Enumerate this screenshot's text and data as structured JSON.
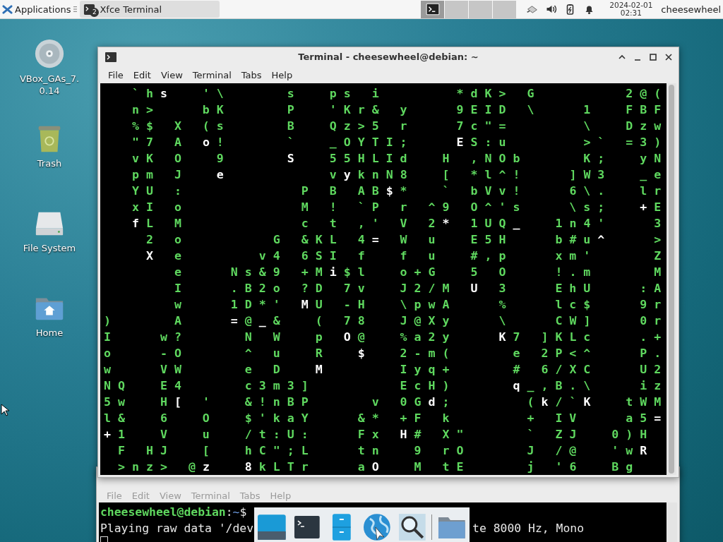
{
  "top_panel": {
    "apps_menu": "Applications",
    "task": {
      "label": "Xfce Terminal",
      "count": "2"
    },
    "workspaces": [
      {
        "selected": true
      },
      {
        "selected": false
      },
      {
        "selected": false
      },
      {
        "selected": false
      }
    ],
    "clock": {
      "date": "2024-02-01",
      "time": "02:31"
    },
    "user": "cheesewheel"
  },
  "desktop_icons": [
    {
      "label": "VBox_GAs_7.0.14",
      "kind": "disc"
    },
    {
      "label": "Trash",
      "kind": "trash"
    },
    {
      "label": "File System",
      "kind": "drive"
    },
    {
      "label": "Home",
      "kind": "home"
    }
  ],
  "front_window": {
    "title": "Terminal - cheesewheel@debian: ~",
    "menu": [
      "File",
      "Edit",
      "View",
      "Terminal",
      "Tabs",
      "Help"
    ],
    "matrix_lines": [
      {
        "runs": [
          {
            "text": "    ` h ",
            "bright": false
          },
          {
            "text": "s",
            "bright": true
          },
          {
            "text": "     ' \\         s     p s   i           * d K >   G             2 @ (",
            "bright": false
          }
        ]
      },
      {
        "runs": [
          {
            "text": "    n >       b K         P     ' K r &   y       9 E I D   \\       1     F B F",
            "bright": false
          }
        ]
      },
      {
        "runs": [
          {
            "text": "    % $   X   ( s         B     Q z > 5   r       7 c \" =           \\     D z w",
            "bright": false
          }
        ]
      },
      {
        "runs": [
          {
            "text": "    \" 7   A   ",
            "bright": false
          },
          {
            "text": "o",
            "bright": true
          },
          {
            "text": " !         `     _ O Y T I ;       ",
            "bright": false
          },
          {
            "text": "E",
            "bright": true
          },
          {
            "text": " S : u           > `   = 3 )",
            "bright": false
          }
        ]
      },
      {
        "runs": [
          {
            "text": "    v K   O     9         ",
            "bright": false
          },
          {
            "text": "S",
            "bright": true
          },
          {
            "text": "     5 5 H L I d     H   , N O b         K ;     y N",
            "bright": false
          }
        ]
      },
      {
        "runs": [
          {
            "text": "    p m   J     ",
            "bright": false
          },
          {
            "text": "e",
            "bright": true
          },
          {
            "text": "               v ",
            "bright": false
          },
          {
            "text": "y",
            "bright": true
          },
          {
            "text": " k n N 8     [   * l ^ !       ] W 3     _ e",
            "bright": false
          }
        ]
      },
      {
        "runs": [
          {
            "text": "    Y U   :                 P   B   A B ",
            "bright": false
          },
          {
            "text": "$",
            "bright": true
          },
          {
            "text": " *     `   b V v !       6 \\ .     l r",
            "bright": false
          }
        ]
      },
      {
        "runs": [
          {
            "text": "    x I   o                 M   !   ` P   r   ^ 9   O ^ ' s       \\ s ;     ",
            "bright": false
          },
          {
            "text": "+",
            "bright": true
          },
          {
            "text": " E",
            "bright": false
          }
        ]
      },
      {
        "runs": [
          {
            "text": "    f",
            "bright": true
          },
          {
            "text": " L   M                 c   t   , '   V   2 ",
            "bright": false
          },
          {
            "text": "*",
            "bright": true
          },
          {
            "text": "   1 U Q ",
            "bright": false
          },
          {
            "text": "_",
            "bright": true
          },
          {
            "text": "     1 n 4 '       3",
            "bright": false
          }
        ]
      },
      {
        "runs": [
          {
            "text": "      2   o             G   & K L   4 ",
            "bright": false
          },
          {
            "text": "=",
            "bright": true
          },
          {
            "text": "   W   u     E 5 H       b # u ",
            "bright": false
          },
          {
            "text": "^",
            "bright": true
          },
          {
            "text": "       >",
            "bright": false
          }
        ]
      },
      {
        "runs": [
          {
            "text": "      X",
            "bright": true
          },
          {
            "text": "   e           v 4   6 S I   f     f   u     # , p       x m '         Z",
            "bright": false
          }
        ]
      },
      {
        "runs": [
          {
            "text": "          e       N s & 9   + M ",
            "bright": false
          },
          {
            "text": "i",
            "bright": true
          },
          {
            "text": " $ l     o + G     5   O       ! . m         M",
            "bright": false
          }
        ]
      },
      {
        "runs": [
          {
            "text": "          I       . B 2 o   ? D   7 v     J 2 / M   ",
            "bright": false
          },
          {
            "text": "U",
            "bright": true
          },
          {
            "text": "   3       E h U       : A",
            "bright": false
          }
        ]
      },
      {
        "runs": [
          {
            "text": "          w       1 D * '   ",
            "bright": false
          },
          {
            "text": "M",
            "bright": true
          },
          {
            "text": " U   - H     \\ p w A       %       l c $       9 r",
            "bright": false
          }
        ]
      },
      {
        "runs": [
          {
            "text": ")         A       ",
            "bright": false
          },
          {
            "text": "=",
            "bright": true
          },
          {
            "text": " @ ",
            "bright": false
          },
          {
            "text": "_",
            "bright": true
          },
          {
            "text": " &     (   7 8     J @ X y       \\       C W ]       0 r",
            "bright": false
          }
        ]
      },
      {
        "runs": [
          {
            "text": "I       w ?         N   W     p   ",
            "bright": false
          },
          {
            "text": "O",
            "bright": true
          },
          {
            "text": " @     % a 2 y       ",
            "bright": false
          },
          {
            "text": "K",
            "bright": true
          },
          {
            "text": " 7   ] K L c       . +",
            "bright": false
          }
        ]
      },
      {
        "runs": [
          {
            "text": "o       - O         ^   u     R     ",
            "bright": false
          },
          {
            "text": "$",
            "bright": true
          },
          {
            "text": "     2 - m (         e   2 P < ^       P .",
            "bright": false
          }
        ]
      },
      {
        "runs": [
          {
            "text": "w       V W         e   D     ",
            "bright": false
          },
          {
            "text": "M",
            "bright": true
          },
          {
            "text": "           I y q +         #   6 / X C       U 2",
            "bright": false
          }
        ]
      },
      {
        "runs": [
          {
            "text": "N Q     E 4         c 3 m 3 ]             E c H )         ",
            "bright": false
          },
          {
            "text": "q",
            "bright": true
          },
          {
            "text": " _ , B . \\       i z",
            "bright": false
          }
        ]
      },
      {
        "runs": [
          {
            "text": "5 w     H ",
            "bright": false
          },
          {
            "text": "[",
            "bright": true
          },
          {
            "text": "   '     & ! n B P         v   0 G ",
            "bright": false
          },
          {
            "text": "d",
            "bright": true
          },
          {
            "text": " ;           ( ",
            "bright": false
          },
          {
            "text": "k",
            "bright": true
          },
          {
            "text": " / ` ",
            "bright": false
          },
          {
            "text": "K",
            "bright": true
          },
          {
            "text": "     t W M",
            "bright": false
          }
        ]
      },
      {
        "runs": [
          {
            "text": "l &     6     O     $ ' k a Y       & *   + F   k           +   I V       a 5 ",
            "bright": false
          },
          {
            "text": "=",
            "bright": true
          }
        ]
      },
      {
        "runs": [
          {
            "text": "+",
            "bright": true
          },
          {
            "text": " 1     V     u     / t : U :       F x   ",
            "bright": false
          },
          {
            "text": "H",
            "bright": true
          },
          {
            "text": " #   X \"         `   Z J     0 ) H",
            "bright": false
          }
        ]
      },
      {
        "runs": [
          {
            "text": "  F   H J     [     h C \" ; L       t n     9   r O         J   / @     ' w ",
            "bright": false
          },
          {
            "text": "R",
            "bright": true
          }
        ]
      },
      {
        "runs": [
          {
            "text": "  > n z >   @ ",
            "bright": false
          },
          {
            "text": "z     8",
            "bright": true
          },
          {
            "text": " k L T r       a ",
            "bright": false
          },
          {
            "text": "O",
            "bright": true
          },
          {
            "text": "     M   t E         j   ' 6     B g",
            "bright": false
          }
        ]
      }
    ]
  },
  "back_window": {
    "menu": [
      "File",
      "Edit",
      "View",
      "Terminal",
      "Tabs",
      "Help"
    ],
    "prompt": {
      "user_host": "cheesewheel@debian",
      "separator": ":",
      "path": "~",
      "symbol": "$"
    },
    "output_parts": [
      "Playing raw data '/dev",
      "te 8000 Hz, Mono"
    ]
  },
  "dock": [
    {
      "kind": "desktop"
    },
    {
      "kind": "terminal"
    },
    {
      "kind": "cabinet"
    },
    {
      "kind": "globe"
    },
    {
      "kind": "search"
    },
    {
      "kind": "separator"
    },
    {
      "kind": "folder"
    }
  ]
}
